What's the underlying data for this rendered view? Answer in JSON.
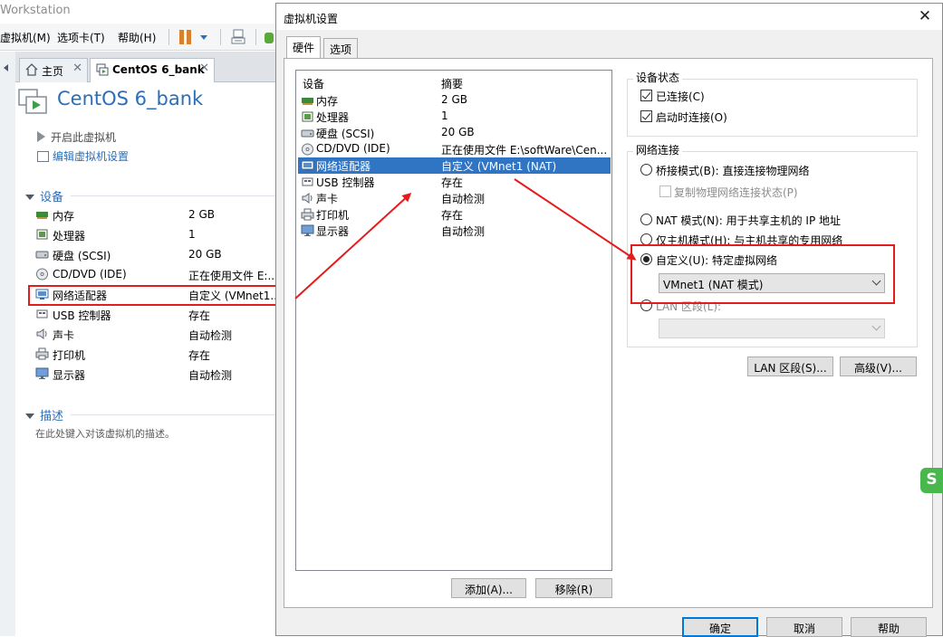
{
  "app": {
    "title_fragment": "Workstation"
  },
  "menubar": {
    "items": [
      "虚拟机(M)",
      "选项卡(T)",
      "帮助(H)"
    ]
  },
  "tabs": [
    {
      "label": "主页",
      "active": false
    },
    {
      "label": "CentOS 6_bank",
      "active": true
    }
  ],
  "vm": {
    "title": "CentOS 6_bank",
    "actions": [
      "开启此虚拟机",
      "编辑虚拟机设置"
    ]
  },
  "sidebar": {
    "devices_heading": "设备",
    "devices": [
      {
        "icon": "memory-icon",
        "name": "内存",
        "value": "2 GB"
      },
      {
        "icon": "processor-icon",
        "name": "处理器",
        "value": "1"
      },
      {
        "icon": "harddisk-icon",
        "name": "硬盘 (SCSI)",
        "value": "20 GB"
      },
      {
        "icon": "cd-dvd-icon",
        "name": "CD/DVD (IDE)",
        "value": "正在使用文件 E:..."
      },
      {
        "icon": "network-adapter-icon",
        "name": "网络适配器",
        "value": "自定义 (VMnet1..."
      },
      {
        "icon": "usb-icon",
        "name": "USB 控制器",
        "value": "存在"
      },
      {
        "icon": "sound-card-icon",
        "name": "声卡",
        "value": "自动检测"
      },
      {
        "icon": "printer-icon",
        "name": "打印机",
        "value": "存在"
      },
      {
        "icon": "display-icon",
        "name": "显示器",
        "value": "自动检测"
      }
    ],
    "description_heading": "描述",
    "description_placeholder": "在此处键入对该虚拟机的描述。"
  },
  "dialog": {
    "title": "虚拟机设置",
    "tabs": [
      "硬件",
      "选项"
    ],
    "list_headers": {
      "device": "设备",
      "summary": "摘要"
    },
    "hardware": [
      {
        "icon": "memory-icon",
        "name": "内存",
        "summary": "2 GB"
      },
      {
        "icon": "processor-icon",
        "name": "处理器",
        "summary": "1"
      },
      {
        "icon": "harddisk-icon",
        "name": "硬盘 (SCSI)",
        "summary": "20 GB"
      },
      {
        "icon": "cd-dvd-icon",
        "name": "CD/DVD (IDE)",
        "summary": "正在使用文件 E:\\softWare\\Cen..."
      },
      {
        "icon": "network-adapter-icon",
        "name": "网络适配器",
        "summary": "自定义 (VMnet1 (NAT)",
        "selected": true
      },
      {
        "icon": "usb-icon",
        "name": "USB 控制器",
        "summary": "存在"
      },
      {
        "icon": "sound-card-icon",
        "name": "声卡",
        "summary": "自动检测"
      },
      {
        "icon": "printer-icon",
        "name": "打印机",
        "summary": "存在"
      },
      {
        "icon": "display-icon",
        "name": "显示器",
        "summary": "自动检测"
      }
    ],
    "add_button": "添加(A)...",
    "remove_button": "移除(R)",
    "device_status": {
      "title": "设备状态",
      "connected": "已连接(C)",
      "connect_at_power_on": "启动时连接(O)"
    },
    "network": {
      "title": "网络连接",
      "bridged": "桥接模式(B): 直接连接物理网络",
      "replicate": "复制物理网络连接状态(P)",
      "nat": "NAT 模式(N): 用于共享主机的 IP 地址",
      "host_only": "仅主机模式(H): 与主机共享的专用网络",
      "custom": "自定义(U): 特定虚拟网络",
      "custom_value": "VMnet1 (NAT 模式)",
      "lan_segment": "LAN 区段(L):",
      "lan_segment_value": ""
    },
    "lan_segments_button": "LAN 区段(S)...",
    "advanced_button": "高级(V)...",
    "ok_button": "确定",
    "cancel_button": "取消",
    "help_button": "帮助"
  },
  "colors": {
    "accent": "#2a6fb9",
    "selection": "#3074c4",
    "annotation": "#e31c1c"
  }
}
